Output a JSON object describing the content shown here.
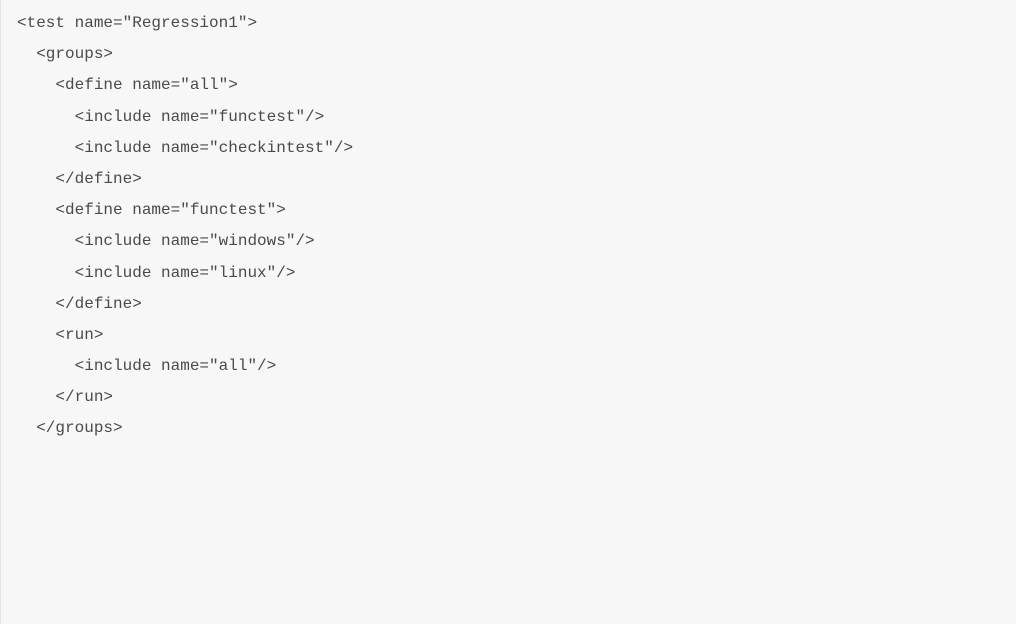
{
  "code": {
    "lines": [
      "<test name=\"Regression1\">",
      "  <groups>",
      "",
      "    <define name=\"all\">",
      "      <include name=\"functest\"/>",
      "      <include name=\"checkintest\"/>",
      "    </define>",
      "",
      "    <define name=\"functest\">",
      "      <include name=\"windows\"/>",
      "      <include name=\"linux\"/>",
      "    </define>",
      "",
      "    <run>",
      "      <include name=\"all\"/>",
      "    </run>",
      "  </groups>"
    ]
  }
}
